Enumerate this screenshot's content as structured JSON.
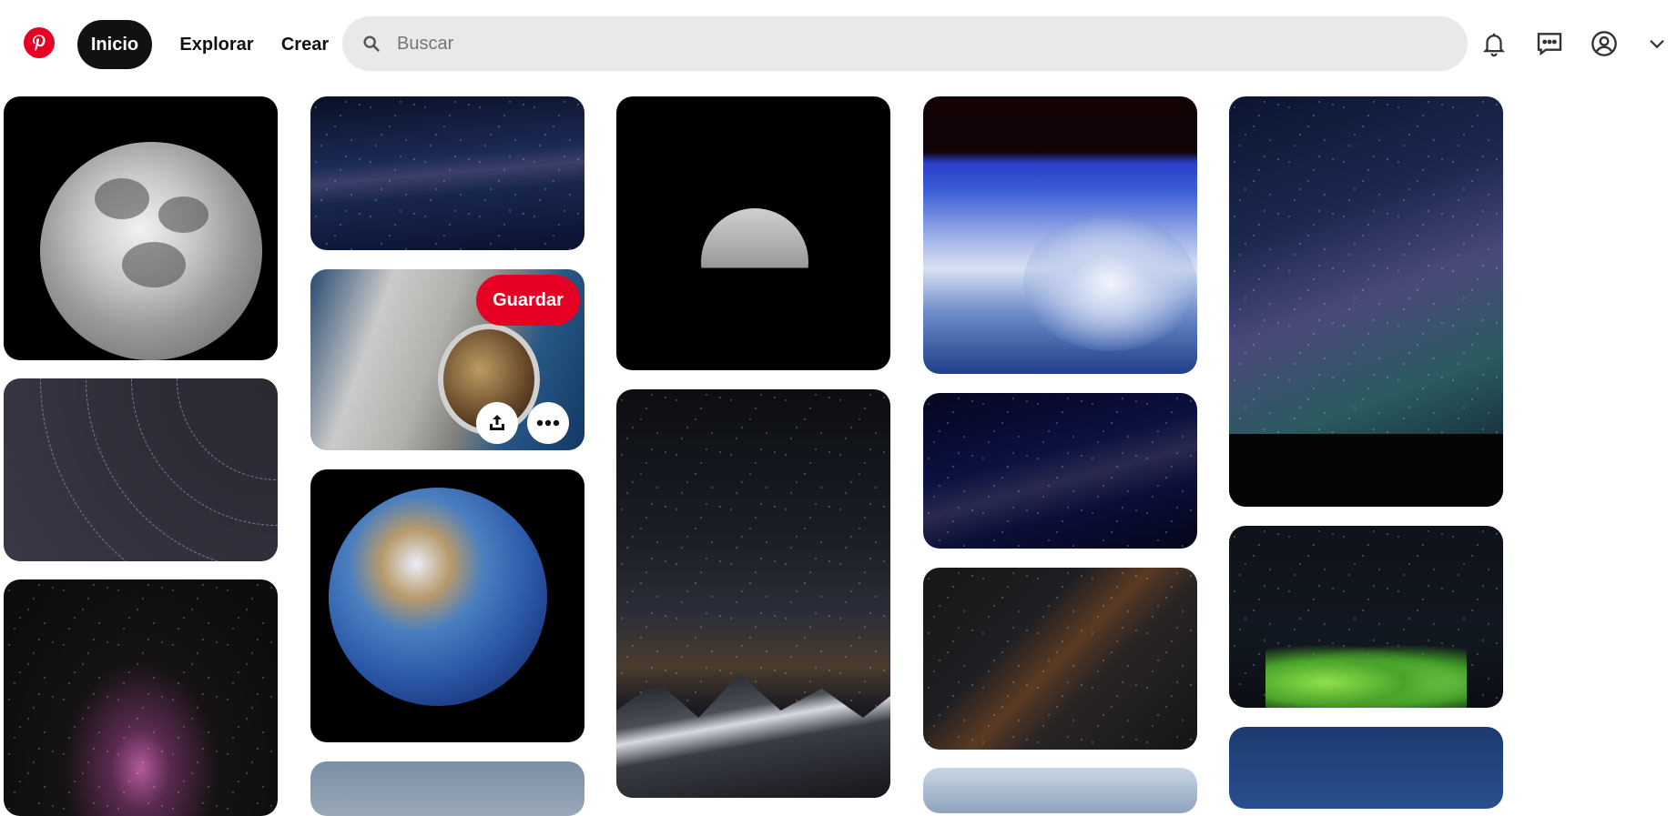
{
  "header": {
    "logo_icon": "pinterest-logo-icon",
    "nav": {
      "home_label": "Inicio",
      "explore_label": "Explorar",
      "create_label": "Crear"
    },
    "search": {
      "placeholder": "Buscar",
      "value": ""
    },
    "icons": [
      "bell-icon",
      "message-icon",
      "user-icon",
      "chevron-down-icon"
    ]
  },
  "pin_overlay": {
    "save_label": "Guardar",
    "share_icon": "share-icon",
    "more_icon": "more-icon"
  },
  "colors": {
    "brand_red": "#e60023",
    "nav_active_bg": "#111111",
    "search_bg": "#e9e9e9"
  }
}
